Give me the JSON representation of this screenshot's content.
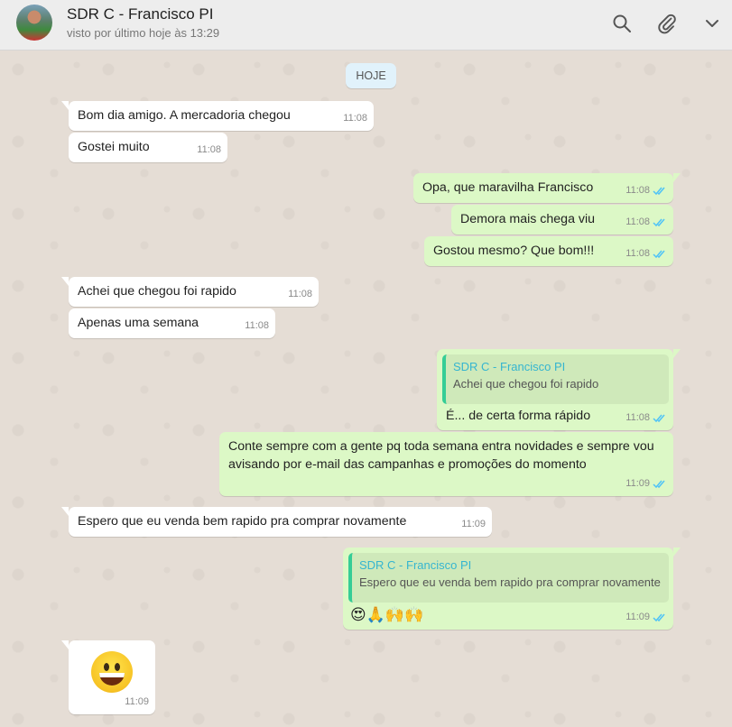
{
  "header": {
    "contact_name": "SDR C - Francisco PI",
    "status": "visto por último hoje às 13:29",
    "icons": [
      "search-icon",
      "paperclip-icon",
      "chevron-down-icon"
    ]
  },
  "chat": {
    "date_badge": "HOJE",
    "messages": [
      {
        "dir": "in",
        "text": "Bom dia amigo. A mercadoria chegou",
        "time": "11:08"
      },
      {
        "dir": "in",
        "text": "Gostei muito",
        "time": "11:08"
      },
      {
        "dir": "out",
        "text": "Opa, que maravilha Francisco",
        "time": "11:08",
        "read": true
      },
      {
        "dir": "out",
        "text": "Demora mais chega viu",
        "time": "11:08",
        "read": true
      },
      {
        "dir": "out",
        "text": "Gostou mesmo? Que bom!!!",
        "time": "11:08",
        "read": true
      },
      {
        "dir": "in",
        "text": "Achei que chegou foi rapido",
        "time": "11:08"
      },
      {
        "dir": "in",
        "text": "Apenas uma semana",
        "time": "11:08"
      },
      {
        "dir": "out",
        "quote_name": "SDR C - Francisco PI",
        "quote_text": "Achei que chegou foi rapido",
        "text": "É... de certa forma rápido",
        "time": "11:08",
        "read": true
      },
      {
        "dir": "out",
        "text": "Conte sempre com a gente pq toda semana entra novidades e sempre vou avisando por e-mail das campanhas e promoções do momento",
        "time": "11:09",
        "read": true
      },
      {
        "dir": "in",
        "text": "Espero que eu venda bem rapido pra comprar novamente",
        "time": "11:09"
      },
      {
        "dir": "out",
        "quote_name": "SDR C - Francisco PI",
        "quote_text": "Espero que eu venda bem rapido pra comprar novamente",
        "text": "😍🙏🙌🙌",
        "time": "11:09",
        "read": true
      },
      {
        "dir": "in",
        "emoji": "grinning-face",
        "time": "11:09"
      }
    ]
  },
  "colors": {
    "incoming_bubble": "#ffffff",
    "outgoing_bubble": "#dcf8c6",
    "read_ticks": "#4fc3f7",
    "quote_name": "#35b5d0",
    "chat_background": "#e5ddd5"
  }
}
